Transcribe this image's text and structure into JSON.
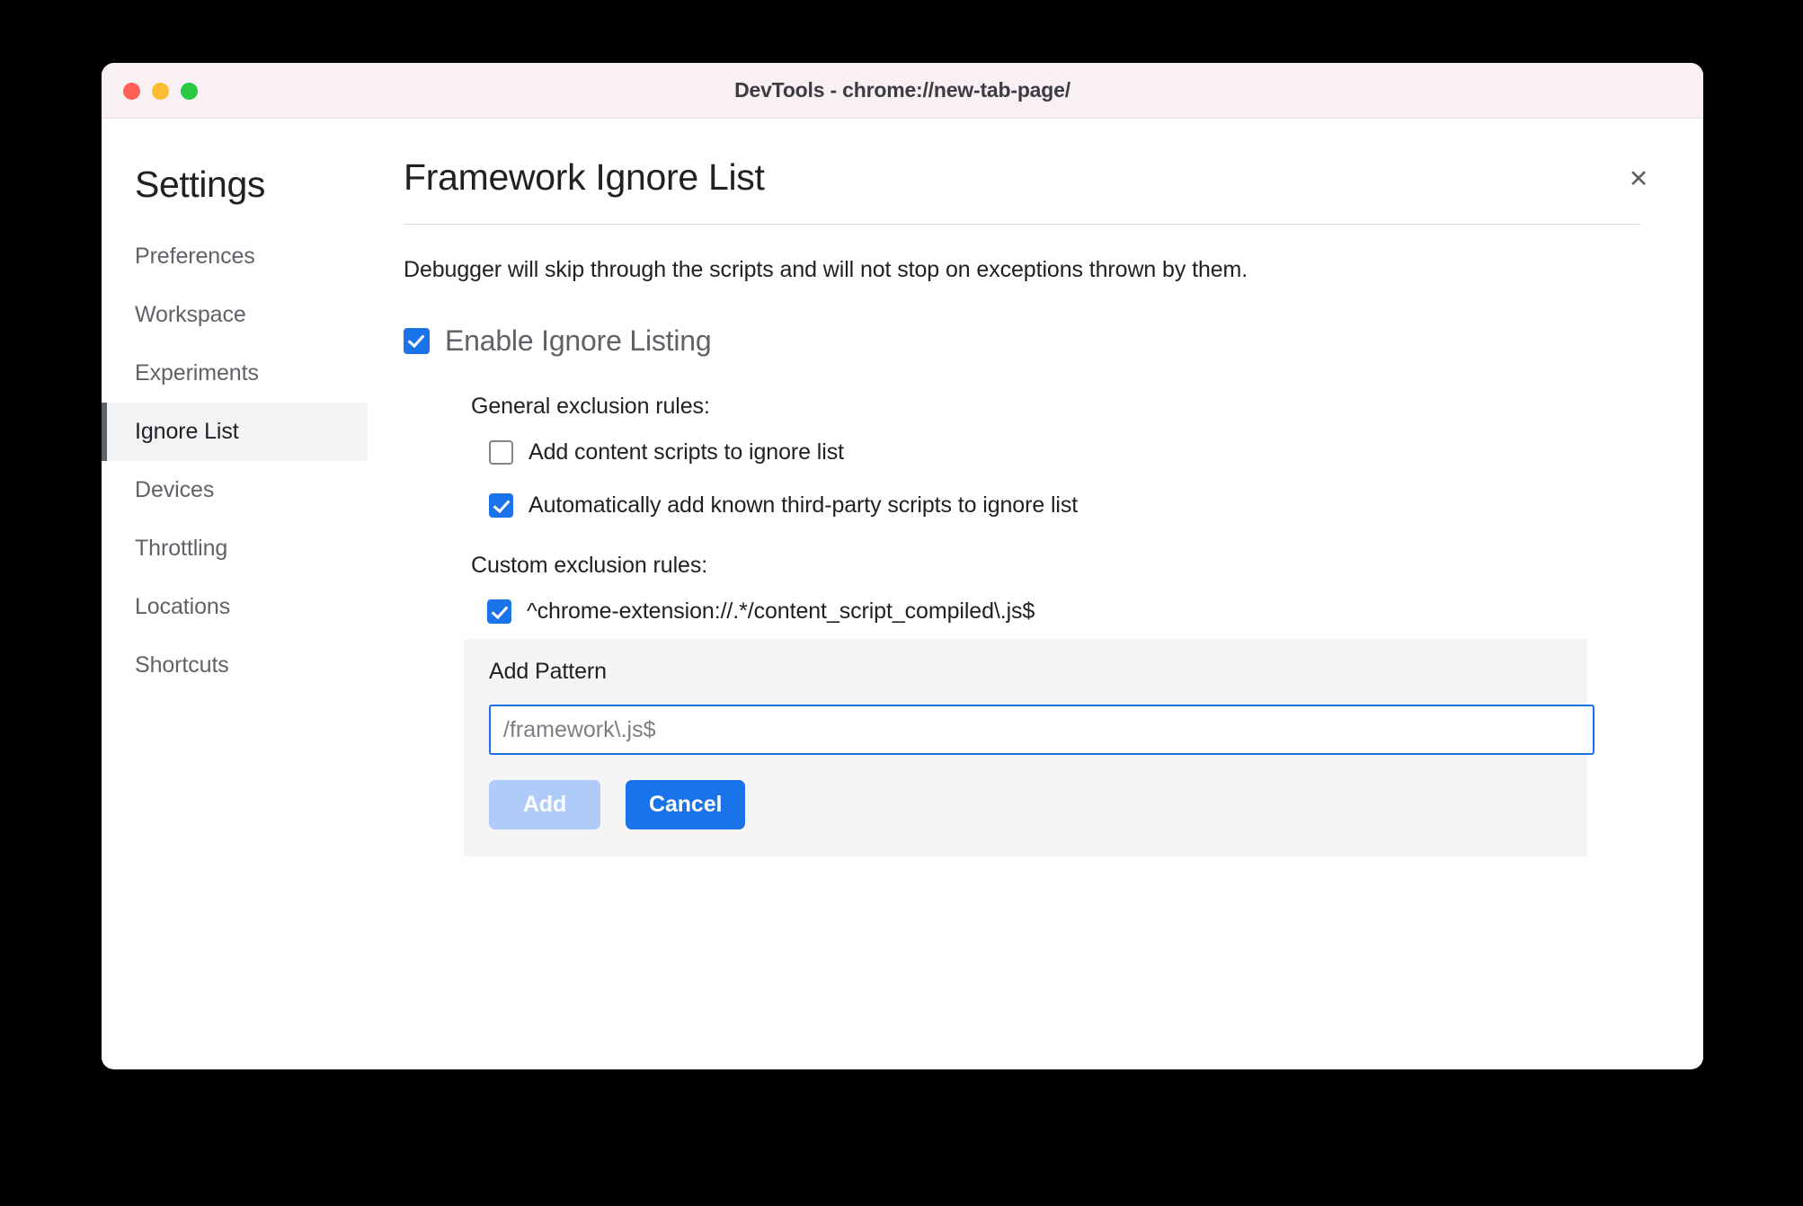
{
  "window": {
    "title": "DevTools - chrome://new-tab-page/",
    "close_icon": "close-icon",
    "traffic_lights": {
      "close": "#ff5f57",
      "minimize": "#f9bd2e",
      "maximize": "#28c840"
    }
  },
  "sidebar": {
    "title": "Settings",
    "items": [
      {
        "label": "Preferences",
        "selected": false
      },
      {
        "label": "Workspace",
        "selected": false
      },
      {
        "label": "Experiments",
        "selected": false
      },
      {
        "label": "Ignore List",
        "selected": true
      },
      {
        "label": "Devices",
        "selected": false
      },
      {
        "label": "Throttling",
        "selected": false
      },
      {
        "label": "Locations",
        "selected": false
      },
      {
        "label": "Shortcuts",
        "selected": false
      }
    ]
  },
  "main": {
    "page_title": "Framework Ignore List",
    "description": "Debugger will skip through the scripts and will not stop on exceptions thrown by them.",
    "enable_ignore_listing": {
      "label": "Enable Ignore Listing",
      "checked": true
    },
    "general_rules": {
      "label": "General exclusion rules:",
      "items": [
        {
          "label": "Add content scripts to ignore list",
          "checked": false
        },
        {
          "label": "Automatically add known third-party scripts to ignore list",
          "checked": true
        }
      ]
    },
    "custom_rules": {
      "label": "Custom exclusion rules:",
      "items": [
        {
          "label": "^chrome-extension://.*/content_script_compiled\\.js$",
          "checked": true
        }
      ]
    },
    "add_pattern": {
      "title": "Add Pattern",
      "input_value": "",
      "input_placeholder": "/framework\\.js$",
      "add_label": "Add",
      "cancel_label": "Cancel",
      "add_disabled": true
    }
  },
  "colors": {
    "accent": "#1a73e8",
    "accent_disabled": "#aecbfa",
    "selected_bg": "#f1f3f4",
    "panel_bg": "#f5f5f5",
    "titlebar_bg": "#f8f0f3"
  }
}
